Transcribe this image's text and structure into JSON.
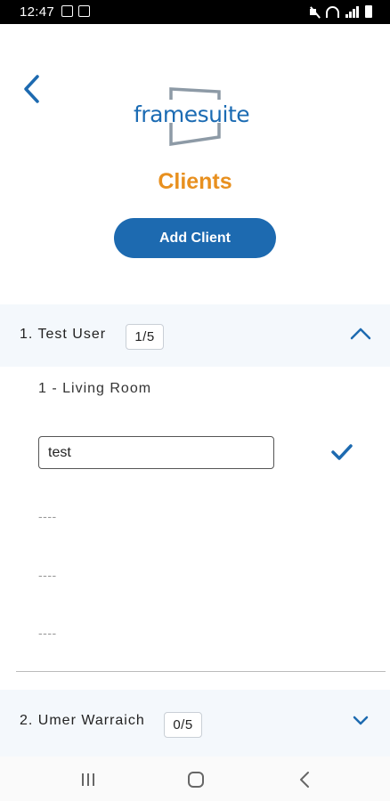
{
  "status_bar": {
    "time": "12:47",
    "icons": [
      "gallery-icon",
      "notification-icon",
      "mute-icon",
      "wifi-icon",
      "signal-icon",
      "battery-icon"
    ]
  },
  "header": {
    "back_icon": "chevron-left-icon",
    "logo_text": "framesuite",
    "title": "Clients",
    "add_button_label": "Add Client"
  },
  "clients": [
    {
      "name": "1.  Test User",
      "count": "1/5",
      "expanded": true,
      "rooms": [
        {
          "label": "1 - Living Room",
          "input_value": "test",
          "items": [
            "----",
            "----",
            "----"
          ]
        }
      ]
    },
    {
      "name": "2.  Umer Warraich",
      "count": "0/5",
      "expanded": false
    }
  ],
  "colors": {
    "accent_blue": "#1d6ab0",
    "title_orange": "#e8901f",
    "logo_gray": "#8d9aa6"
  },
  "nav_bar": {
    "icons": [
      "recent-apps-icon",
      "home-icon",
      "back-icon"
    ]
  }
}
